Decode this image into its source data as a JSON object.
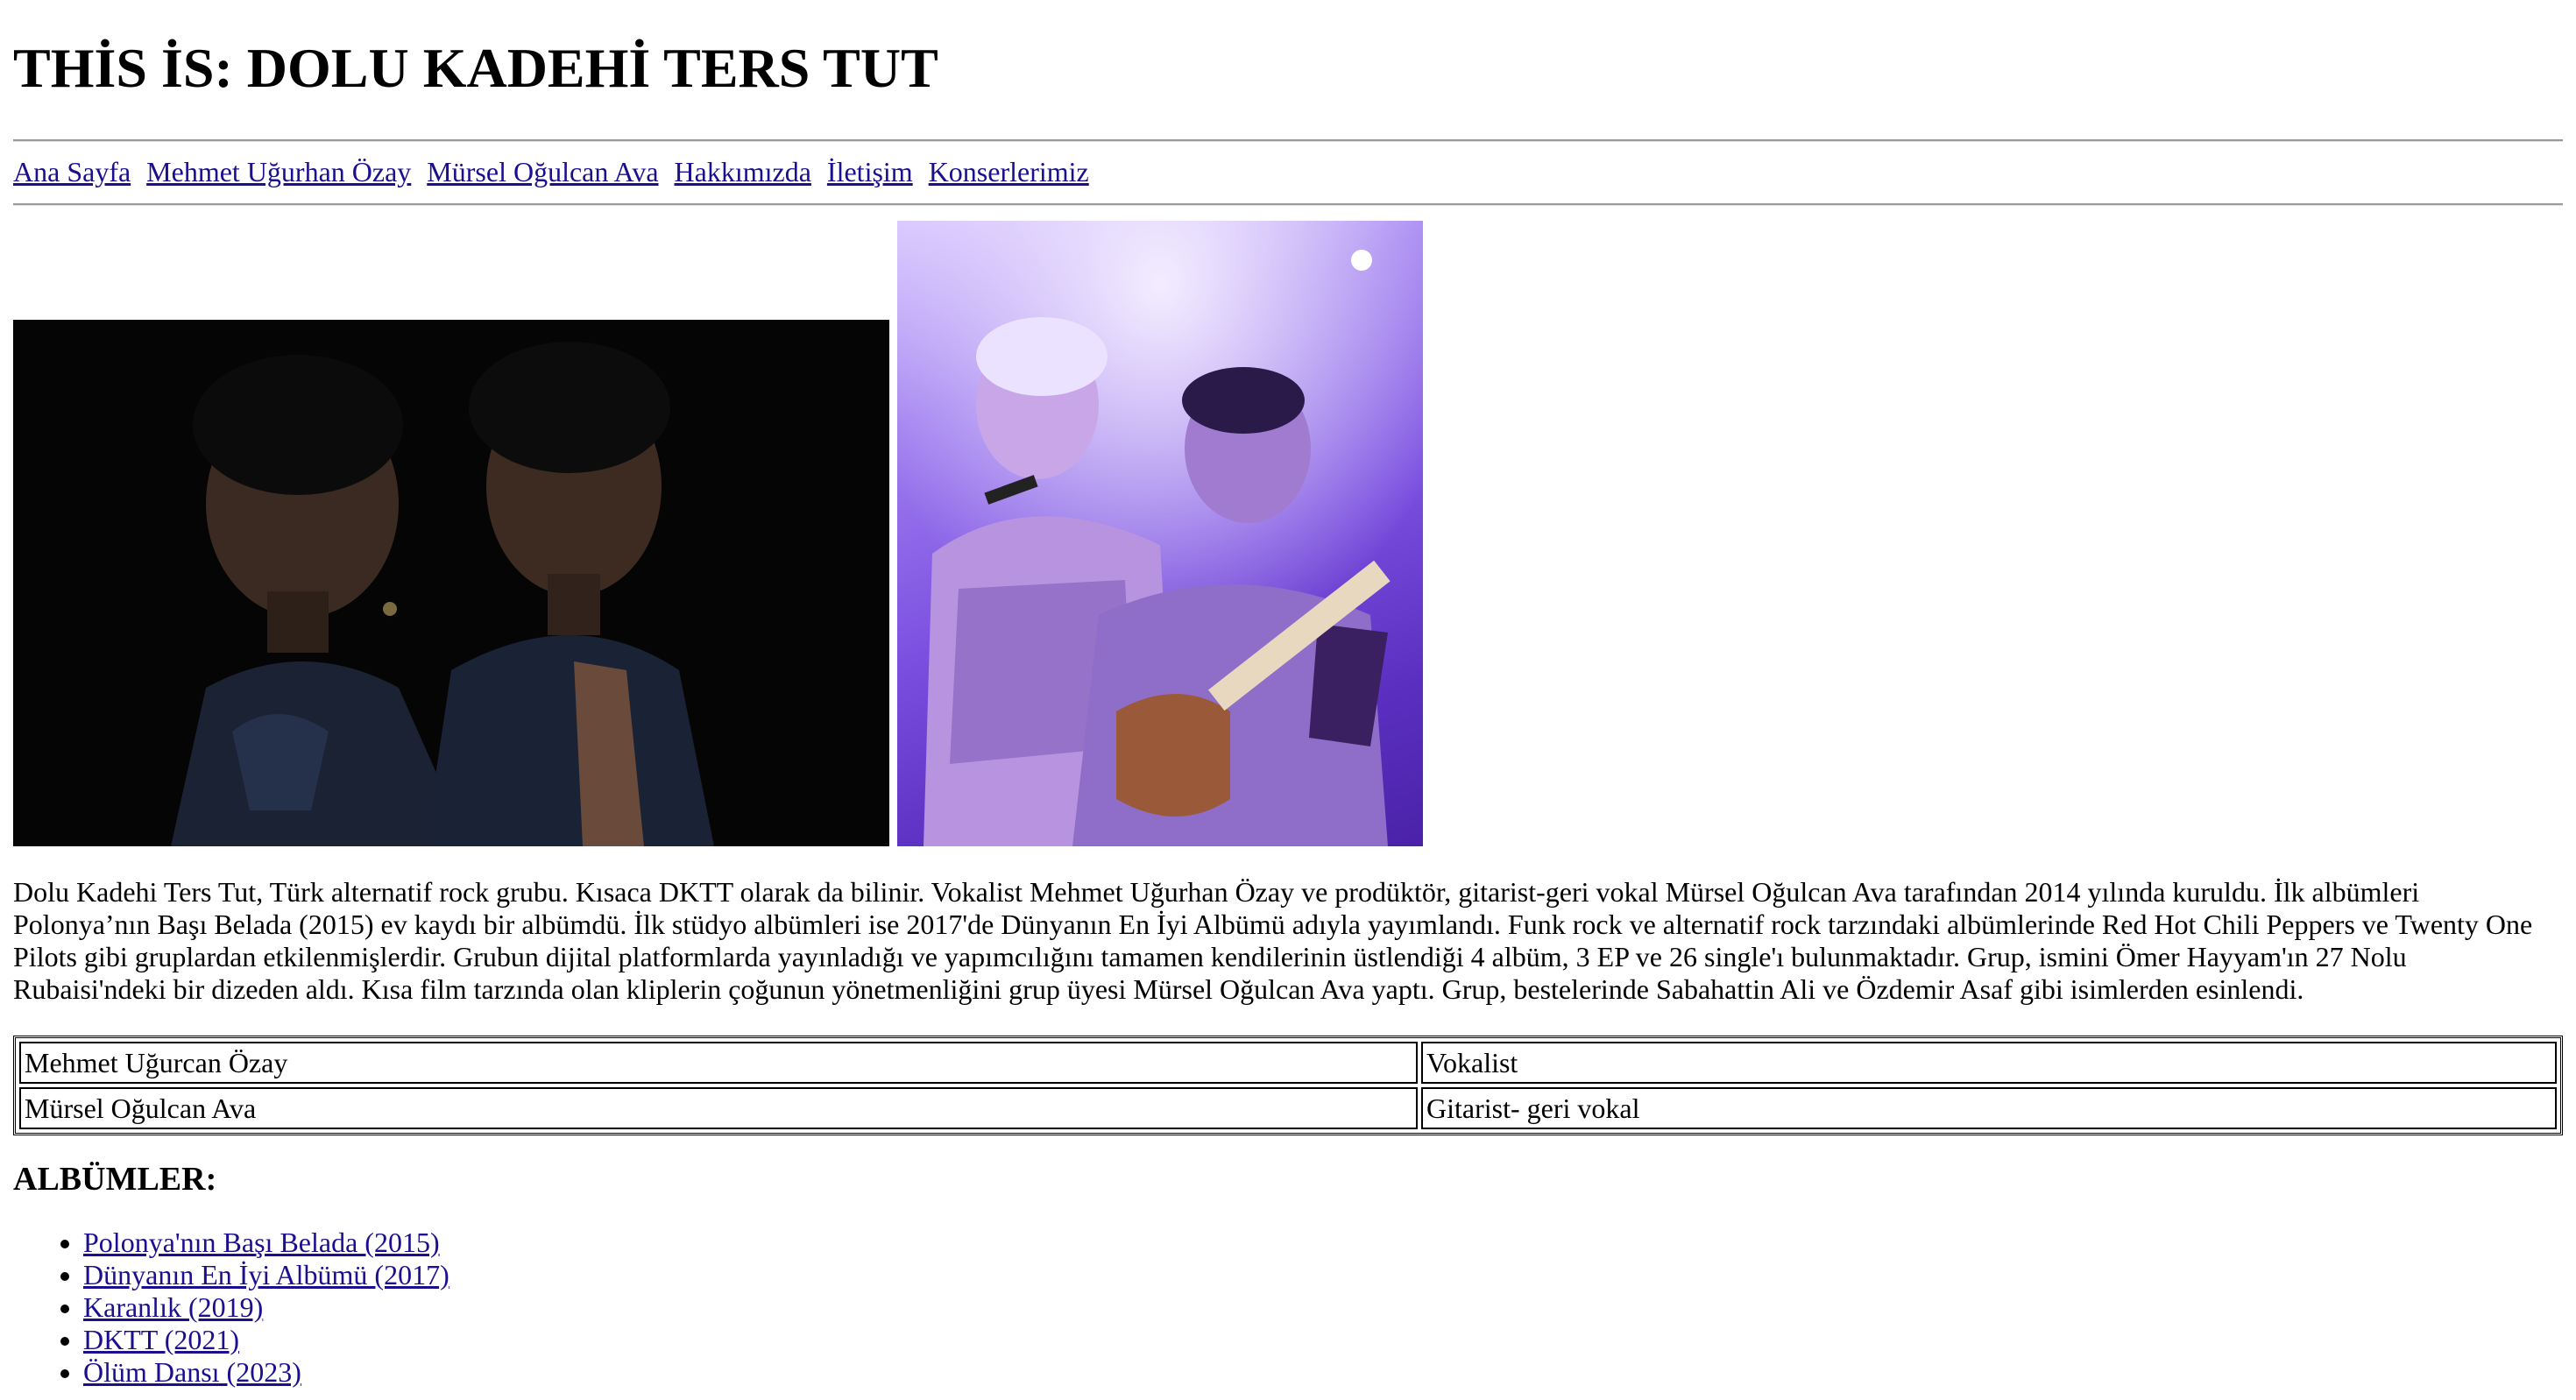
{
  "header": {
    "title": "THİS İS: DOLU KADEHİ TERS TUT"
  },
  "nav": {
    "items": [
      {
        "label": "Ana Sayfa"
      },
      {
        "label": "Mehmet Uğurhan Özay"
      },
      {
        "label": "Mürsel Oğulcan Ava"
      },
      {
        "label": "Hakkımızda"
      },
      {
        "label": "İletişim"
      },
      {
        "label": "Konserlerimiz"
      }
    ]
  },
  "intro": {
    "text": "Dolu Kadehi Ters Tut, Türk alternatif rock grubu. Kısaca DKTT olarak da bilinir. Vokalist Mehmet Uğurhan Özay ve prodüktör, gitarist-geri vokal Mürsel Oğulcan Ava tarafından 2014 yılında kuruldu. İlk albümleri Polonya’nın Başı Belada (2015) ev kaydı bir albümdü. İlk stüdyo albümleri ise 2017'de Dünyanın En İyi Albümü adıyla yayımlandı. Funk rock ve alternatif rock tarzındaki albümlerinde Red Hot Chili Peppers ve Twenty One Pilots gibi gruplardan etkilenmişlerdir. Grubun dijital platformlarda yayınladığı ve yapımcılığını tamamen kendilerinin üstlendiği 4 albüm, 3 EP ve 26 single'ı bulunmaktadır. Grup, ismini Ömer Hayyam'ın 27 Nolu Rubaisi'ndeki bir dizeden aldı. Kısa film tarzında olan kliplerin çoğunun yönetmenliğini grup üyesi Mürsel Oğulcan Ava yaptı. Grup, bestelerinde Sabahattin Ali ve Özdemir Asaf gibi isimlerden esinlendi."
  },
  "members": [
    {
      "name": "Mehmet Uğurcan Özay",
      "role": "Vokalist"
    },
    {
      "name": "Mürsel Oğulcan Ava",
      "role": "Gitarist- geri vokal"
    }
  ],
  "albums": {
    "title": "ALBÜMLER:",
    "items": [
      {
        "label": "Polonya'nın Başı Belada (2015)"
      },
      {
        "label": "Dünyanın En İyi Albümü (2017)"
      },
      {
        "label": "Karanlık (2019)"
      },
      {
        "label": "DKTT (2021)"
      },
      {
        "label": "Ölüm Dansı (2023)"
      }
    ]
  },
  "colors": {
    "link": "#1b0f8f",
    "photo1_bg": "#050505",
    "photo2_tint": "#7a4fe0"
  }
}
